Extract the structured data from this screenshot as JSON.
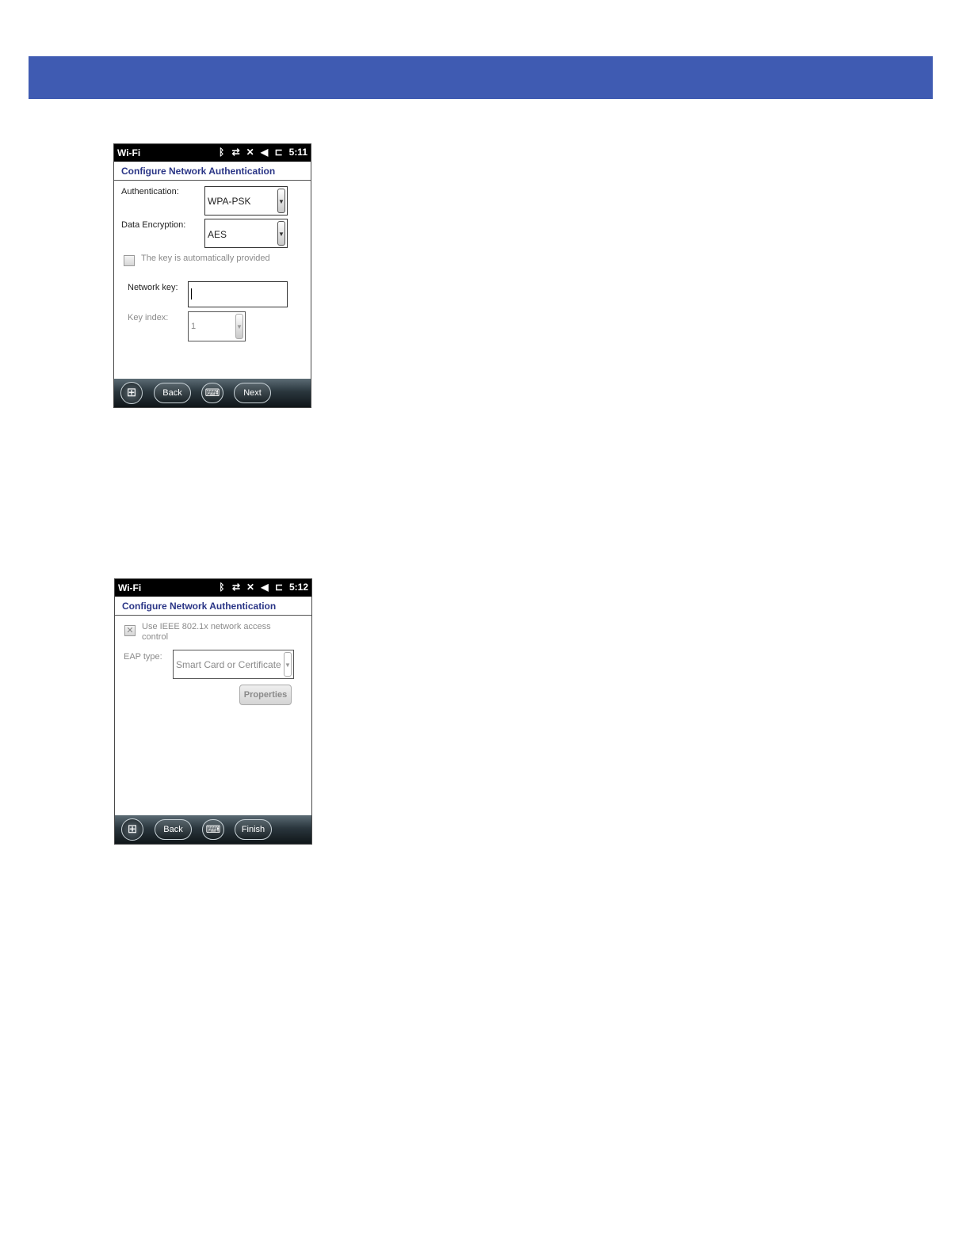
{
  "screens": [
    {
      "status": {
        "app_name": "Wi-Fi",
        "time": "5:11"
      },
      "title": "Configure Network Authentication",
      "authentication": {
        "label": "Authentication:",
        "value": "WPA-PSK"
      },
      "data_encryption": {
        "label": "Data Encryption:",
        "value": "AES"
      },
      "auto_key": {
        "label": "The key is automatically provided"
      },
      "network_key": {
        "label": "Network key:",
        "value": ""
      },
      "key_index": {
        "label": "Key index:",
        "value": "1"
      },
      "softkeys": {
        "left": "Back",
        "right": "Next"
      }
    },
    {
      "status": {
        "app_name": "Wi-Fi",
        "time": "5:12"
      },
      "title": "Configure Network Authentication",
      "ieee": {
        "label_line1": "Use IEEE 802.1x network access",
        "label_line2": "control",
        "mark": "✕"
      },
      "eap_type": {
        "label": "EAP type:",
        "value": "Smart Card or Certificate"
      },
      "properties_label": "Properties",
      "softkeys": {
        "left": "Back",
        "right": "Finish"
      }
    }
  ],
  "icons": [
    "bluetooth-icon",
    "sync-arrows-icon",
    "signal-off-icon",
    "speaker-muted-icon",
    "battery-plug-icon",
    "start-windows-icon",
    "keyboard-icon",
    "dropdown-arrow-icon"
  ],
  "colors": {
    "banner": "#3f5bb2",
    "title": "#2a3586"
  }
}
